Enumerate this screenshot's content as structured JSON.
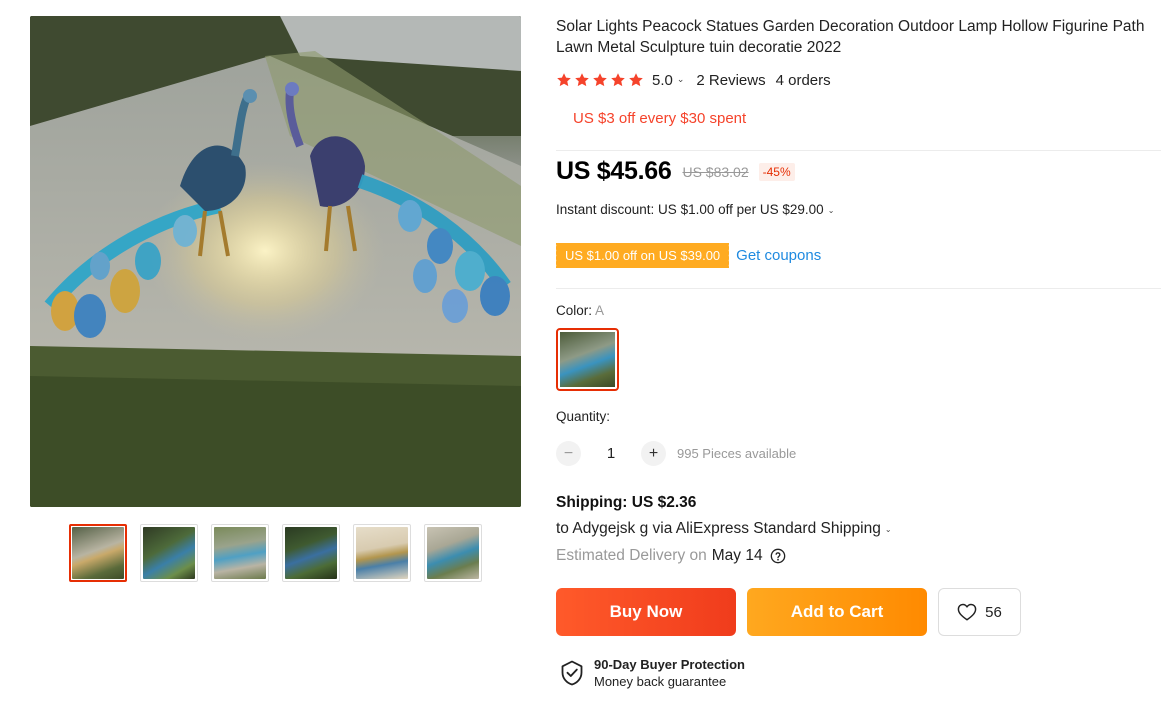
{
  "product": {
    "title": "Solar Lights Peacock Statues Garden Decoration Outdoor Lamp Hollow Figurine Path Lawn Metal Sculpture tuin decoratie 2022",
    "rating": "5.0",
    "stars": 5,
    "reviews": "2 Reviews",
    "orders": "4 orders",
    "store_coupon": "US $3 off every $30 spent"
  },
  "pricing": {
    "price": "US $45.66",
    "original_price": "US $83.02",
    "discount": "-45%",
    "instant_discount": "Instant discount: US $1.00 off per US $29.00",
    "coupon_chip": "US $1.00 off on US $39.00",
    "get_coupons": "Get coupons"
  },
  "variant": {
    "color_label": "Color:",
    "color_value": "A"
  },
  "quantity": {
    "label": "Quantity:",
    "value": "1",
    "minus": "−",
    "plus": "+",
    "available": "995 Pieces available"
  },
  "shipping": {
    "title": "Shipping: US $2.36",
    "via": "to Adygejsk g via AliExpress Standard Shipping",
    "eta_label": "Estimated Delivery on",
    "eta_date": "May 14"
  },
  "actions": {
    "buy_now": "Buy Now",
    "add_to_cart": "Add to Cart",
    "wishlist_count": "56"
  },
  "protection": {
    "title": "90-Day Buyer Protection",
    "subtitle": "Money back guarantee"
  },
  "gallery": {
    "thumbnail_count": 6,
    "active_index": 0
  },
  "colors": {
    "accent_red": "#e62e04",
    "sale_red": "#f5432b",
    "coupon_orange": "#ffab21",
    "link_blue": "#1f8ae0",
    "buy_gradient": "#ff5a2a",
    "cart_gradient": "#ffa81f",
    "star_color": "#f5432b"
  },
  "icons": {
    "star": "star-icon",
    "chevron": "chevron-down-icon",
    "help": "help-circle-icon",
    "heart": "heart-icon",
    "shield": "shield-check-icon"
  }
}
